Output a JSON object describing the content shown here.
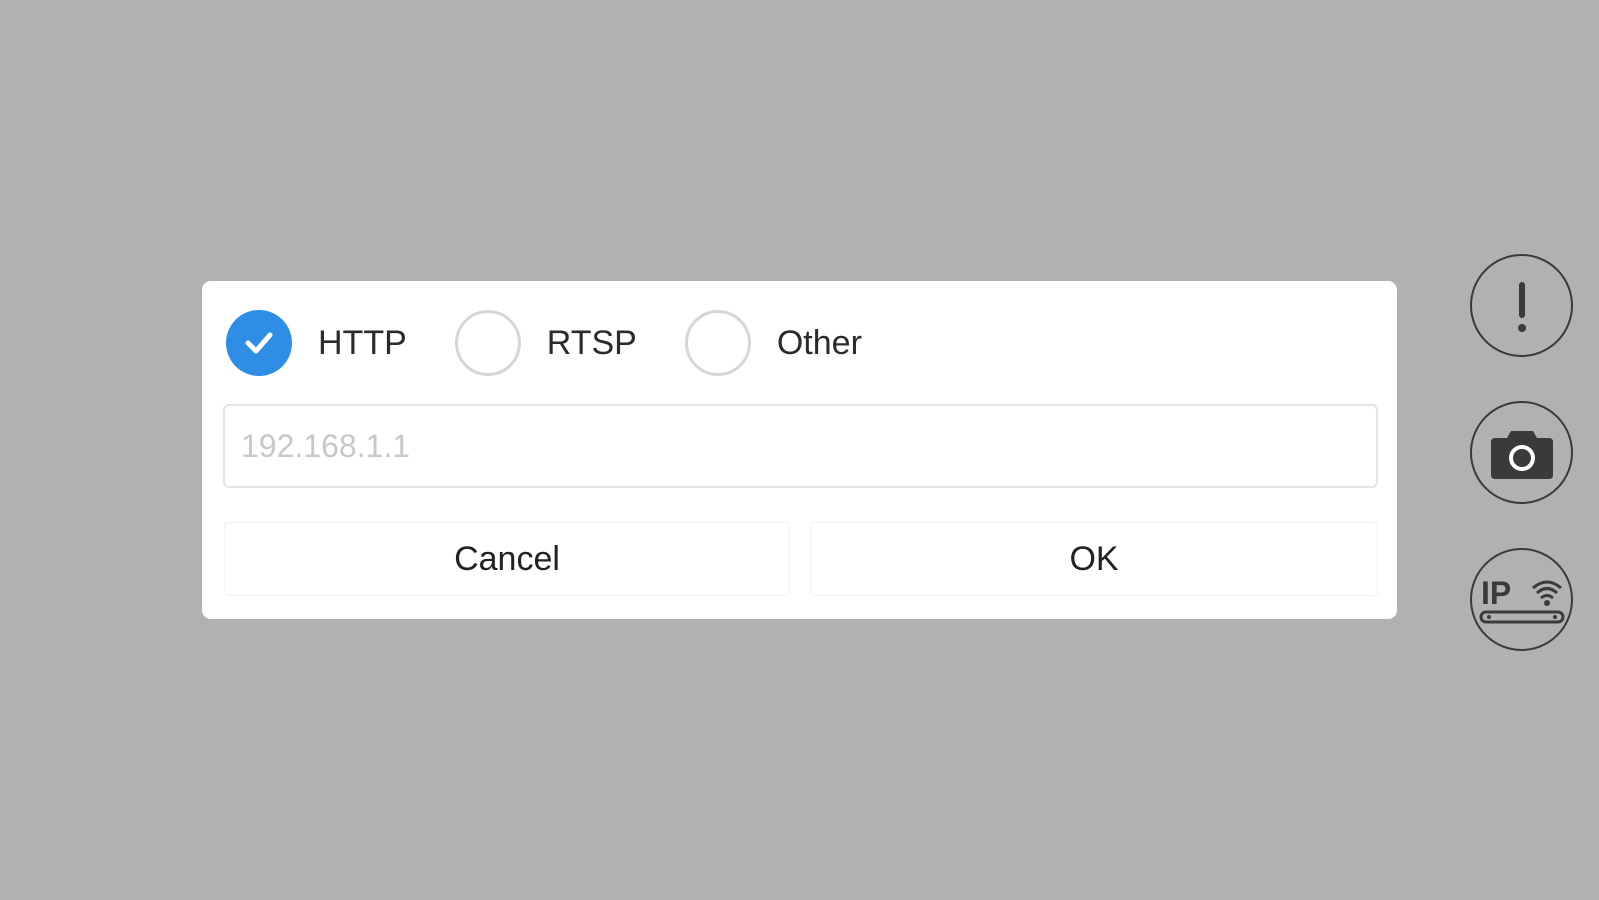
{
  "dialog": {
    "protocols": [
      {
        "label": "HTTP",
        "checked": true
      },
      {
        "label": "RTSP",
        "checked": false
      },
      {
        "label": "Other",
        "checked": false
      }
    ],
    "address": {
      "value": "",
      "placeholder": "192.168.1.1"
    },
    "cancel_label": "Cancel",
    "ok_label": "OK",
    "accent_color": "#2e8ee6"
  },
  "side_toolbar": {
    "buttons": [
      {
        "icon": "exclamation-icon"
      },
      {
        "icon": "camera-icon"
      },
      {
        "icon": "ip-wifi-icon",
        "text": "IP"
      }
    ]
  }
}
